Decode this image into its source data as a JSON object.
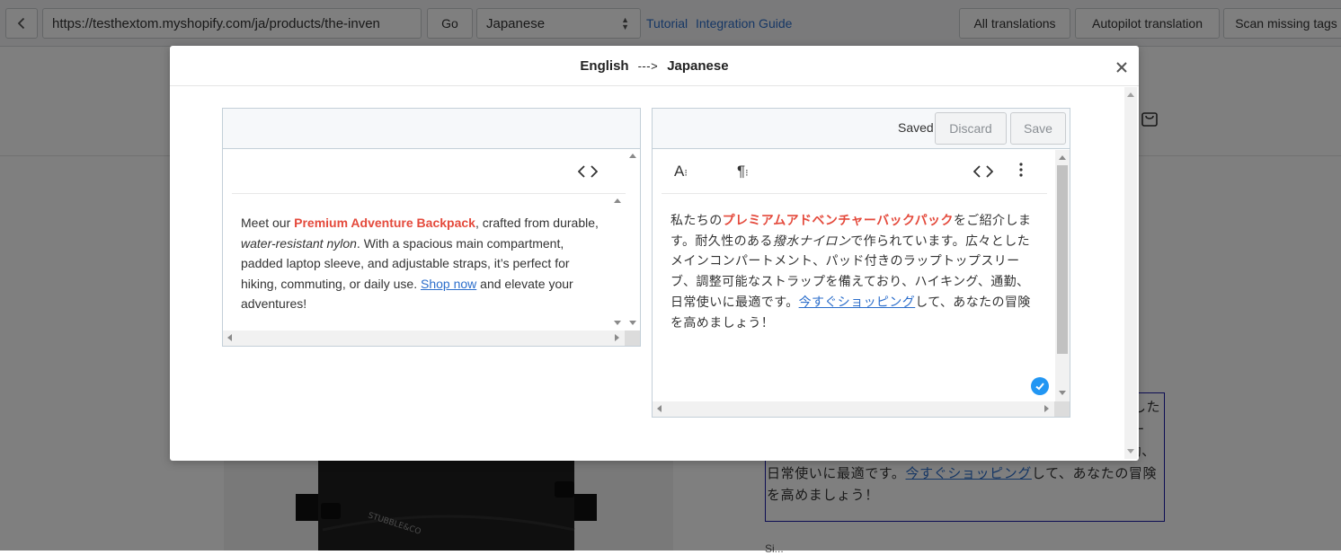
{
  "topbar": {
    "url": "https://testhextom.myshopify.com/ja/products/the-inven",
    "go_label": "Go",
    "language_selected": "Japanese",
    "tutorial_link": "Tutorial",
    "integration_link": "Integration Guide",
    "all_translations_label": "All translations",
    "autopilot_label": "Autopilot translation",
    "scan_missing_label": "Scan missing tags"
  },
  "background": {
    "jp_desc_pre": "私たちのプレミアムアドベンチャーバックパックをご紹介します。耐久性のある撥水ナイロンで作られています。広々としたメインコンパートメント、パッド付きのラップトップスリーブ、調整可能なストラップを備えており、ハイキング、通勤、日常使いに最適です。",
    "jp_desc_link": "今すぐショッピング",
    "jp_desc_post": "して、あなたの冒険を高めましょう！",
    "below_text": "Si..."
  },
  "modal": {
    "source_lang": "English",
    "arrow": "--->",
    "target_lang": "Japanese"
  },
  "source": {
    "text_1": "Meet our ",
    "brand": "Premium Adventure Backpack",
    "text_2": ", crafted from durable, ",
    "material": "water-resistant nylon",
    "text_3": ". With a spacious main compartment, padded laptop sleeve, and adjustable straps, it’s perfect for hiking, commuting, or daily use. ",
    "link": "Shop now",
    "text_4": " and elevate your adventures!"
  },
  "target": {
    "status": "Saved",
    "discard_label": "Discard",
    "save_label": "Save",
    "text_1": "私たちの",
    "brand": "プレミアムアドベンチャーバックパック",
    "text_2": "をご紹介します。耐久性のある",
    "material": "撥水ナイロン",
    "text_3": "で作られています。広々としたメインコンパートメント、パッド付きのラップトップスリーブ、調整可能なストラップを備えており、ハイキング、通勤、日常使いに最適です。",
    "link": "今すぐショッピング",
    "text_4": "して、あなたの冒険を高めましょう！"
  },
  "icons": {
    "back": "chevron-left-icon",
    "cart": "shopping-bag-icon",
    "close": "close-icon",
    "code": "code-icon",
    "font_size": "font-size-icon",
    "paragraph": "paragraph-icon",
    "more": "more-vertical-icon",
    "check": "check-circle-icon"
  },
  "colors": {
    "brand_red": "#e44a3c",
    "link_blue": "#2c6ecb",
    "check_blue": "#2196f3"
  }
}
